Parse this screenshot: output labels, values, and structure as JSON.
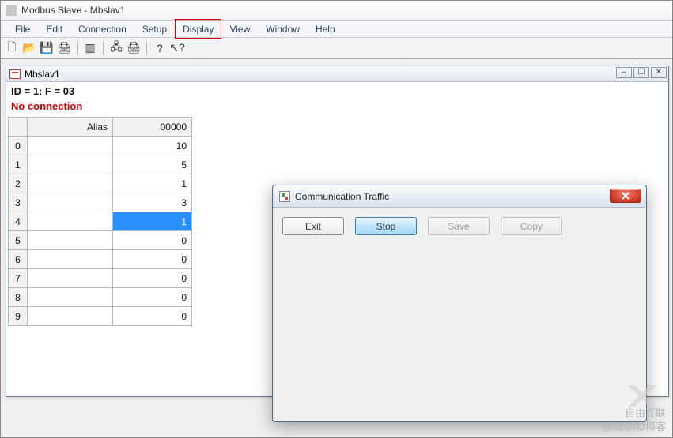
{
  "app": {
    "title": "Modbus Slave - Mbslav1"
  },
  "menu": {
    "file": "File",
    "edit": "Edit",
    "connection": "Connection",
    "setup": "Setup",
    "display": "Display",
    "view": "View",
    "window": "Window",
    "help": "Help",
    "highlighted": "display"
  },
  "toolbar_icons": {
    "new": "🗋",
    "open": "📂",
    "save": "💾",
    "print": "🖨",
    "registers": "▥",
    "comm1": "🖧",
    "comm2": "🖨",
    "help": "?",
    "whatsthis": "↖?"
  },
  "child": {
    "title": "Mbslav1",
    "status_id": "ID = 1: F = 03",
    "status_conn": "No connection",
    "columns": {
      "alias": "Alias",
      "val": "00000"
    },
    "rows": [
      {
        "idx": "0",
        "alias": "",
        "val": "10",
        "selected": false
      },
      {
        "idx": "1",
        "alias": "",
        "val": "5",
        "selected": false
      },
      {
        "idx": "2",
        "alias": "",
        "val": "1",
        "selected": false
      },
      {
        "idx": "3",
        "alias": "",
        "val": "3",
        "selected": false
      },
      {
        "idx": "4",
        "alias": "",
        "val": "1",
        "selected": true
      },
      {
        "idx": "5",
        "alias": "",
        "val": "0",
        "selected": false
      },
      {
        "idx": "6",
        "alias": "",
        "val": "0",
        "selected": false
      },
      {
        "idx": "7",
        "alias": "",
        "val": "0",
        "selected": false
      },
      {
        "idx": "8",
        "alias": "",
        "val": "0",
        "selected": false
      },
      {
        "idx": "9",
        "alias": "",
        "val": "0",
        "selected": false
      }
    ]
  },
  "dialog": {
    "title": "Communication Traffic",
    "buttons": {
      "exit": "Exit",
      "stop": "Stop",
      "save": "Save",
      "copy": "Copy"
    }
  },
  "watermark": {
    "brand": "自由互联",
    "sub": "@51CTO博客"
  }
}
